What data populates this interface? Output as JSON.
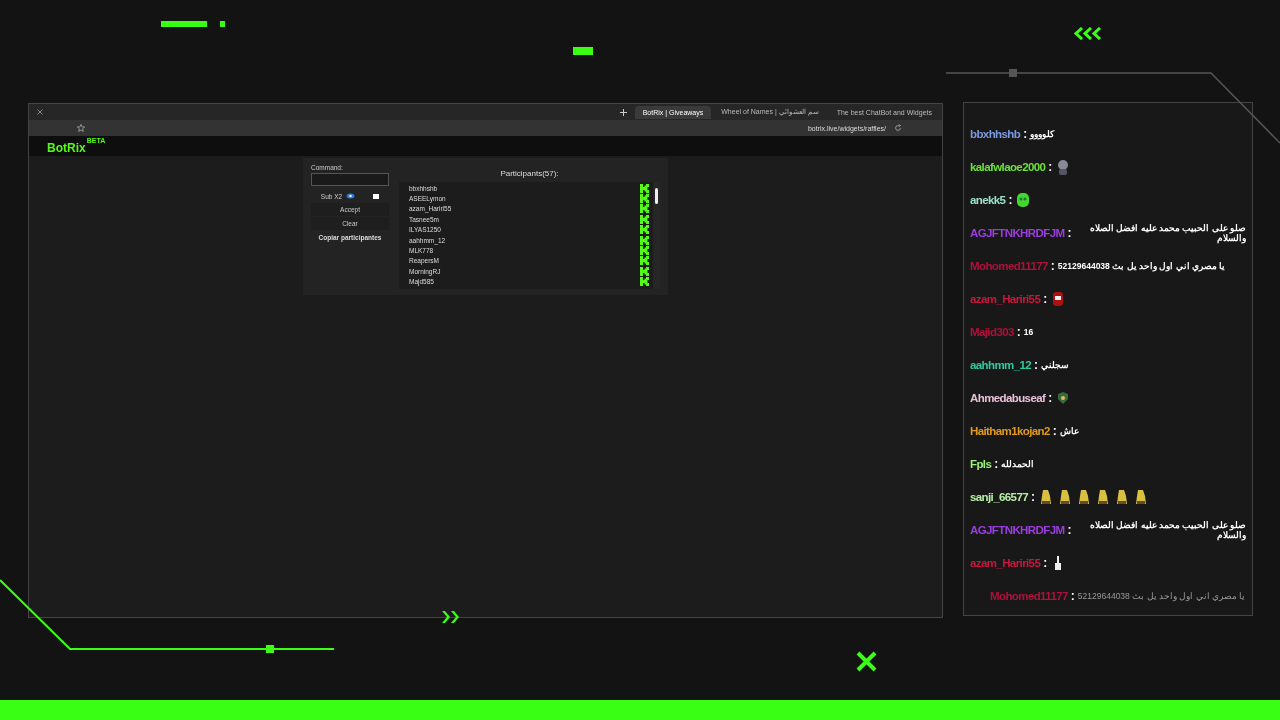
{
  "browser": {
    "tabs": [
      {
        "label": "BotRix | Giveaways",
        "selected": true
      },
      {
        "label": "Wheel of Names | سم العشوائي",
        "selected": false
      },
      {
        "label": "The best ChatBot and Widgets",
        "selected": false
      }
    ],
    "url": "botrix.live/widgets/raffles/"
  },
  "site": {
    "logo": "BotRix",
    "badge": "BETA"
  },
  "raffle": {
    "command_label": "Command:",
    "option_label": "Sub X2",
    "option_checked": false,
    "buttons": [
      "Accept",
      "Clear",
      "Copiar participantes"
    ],
    "participants_title": "Participants(57):",
    "participants": [
      "bbxhhshb",
      "ASEELymon",
      "azam_Hariri55",
      "Tasnee5m",
      "ILYAS1250",
      "aahhmm_12",
      "MLK778",
      "ReapersM",
      "MorningRJ",
      "Majd585"
    ]
  },
  "chat": [
    {
      "user": "bbxhhshb",
      "color": "#7b9be0",
      "separator": ":",
      "kind": "text",
      "text": "كلوووو",
      "faded": false
    },
    {
      "user": "kalafwlaoe2000",
      "color": "#6ee03a",
      "separator": ":",
      "kind": "emote",
      "emotes": [
        {
          "kind": "face"
        }
      ],
      "faded": false
    },
    {
      "user": "anekk5",
      "color": "#9de0c8",
      "separator": ":",
      "kind": "emote",
      "emotes": [
        {
          "kind": "blob"
        }
      ],
      "faded": false
    },
    {
      "user": "AGJFTNKHRDFJM",
      "color": "#9b3de0",
      "separator": ":",
      "kind": "text",
      "text": "صلو على الحبيب محمد عليه افضل الصلاه والسلام",
      "faded": false
    },
    {
      "user": "Mohomed11177",
      "color": "#b0103a",
      "separator": ":",
      "kind": "text",
      "text": "يا مصري اني اول واحد يل بث 52129644038",
      "faded": false
    },
    {
      "user": "azam_Hariri55",
      "color": "#c8163c",
      "separator": ":",
      "kind": "emote",
      "emotes": [
        {
          "kind": "robot"
        }
      ],
      "faded": false
    },
    {
      "user": "Majid303",
      "color": "#b0103a",
      "separator": ":",
      "kind": "text",
      "text": "16",
      "faded": false
    },
    {
      "user": "aahhmm_12",
      "color": "#2ec9a0",
      "separator": ":",
      "kind": "text",
      "text": "سجلني",
      "faded": false
    },
    {
      "user": "Ahmedabuseaf",
      "color": "#e8c0d8",
      "separator": ":",
      "kind": "emote",
      "emotes": [
        {
          "kind": "shield"
        }
      ],
      "faded": false
    },
    {
      "user": "Haitham1kojan2",
      "color": "#e09a1c",
      "separator": ":",
      "kind": "text",
      "text": "عاش",
      "faded": false
    },
    {
      "user": "Fpls",
      "color": "#9ef07a",
      "separator": ":",
      "kind": "text",
      "text": "الحمدلله",
      "faded": false
    },
    {
      "user": "sanji_66577",
      "color": "#b8f0a8",
      "separator": ":",
      "kind": "emote",
      "emotes": [
        {
          "kind": "duck"
        },
        {
          "kind": "duck"
        },
        {
          "kind": "duck"
        },
        {
          "kind": "duck"
        },
        {
          "kind": "duck"
        },
        {
          "kind": "duck"
        }
      ],
      "faded": false
    },
    {
      "user": "AGJFTNKHRDFJM",
      "color": "#9b3de0",
      "separator": ":",
      "kind": "text",
      "text": "صلو على الحبيب محمد عليه افضل الصلاه والسلام",
      "faded": false
    },
    {
      "user": "azam_Hariri55",
      "color": "#c8163c",
      "separator": ":",
      "kind": "emote",
      "emotes": [
        {
          "kind": "hand"
        }
      ],
      "faded": false
    },
    {
      "user": "Mohomed11177",
      "color": "#b0103a",
      "separator": ":",
      "kind": "text",
      "text": "يا مصري اني اول واحد يل بث 52129644038",
      "faded": true
    }
  ]
}
